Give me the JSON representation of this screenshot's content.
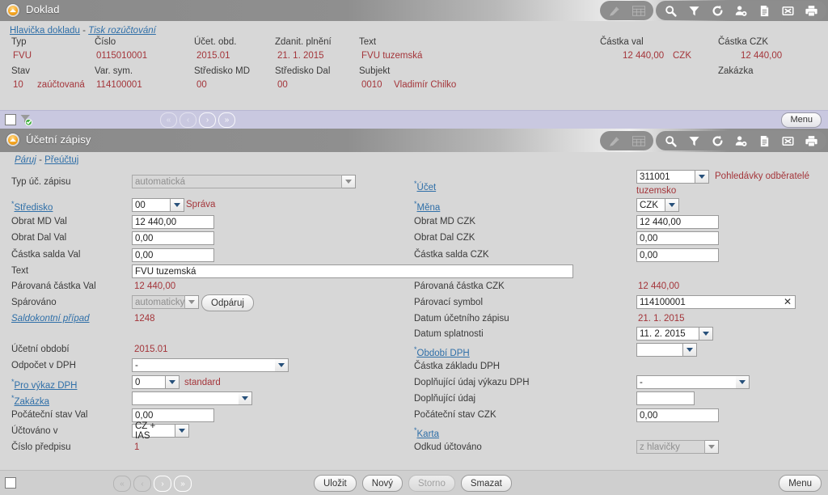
{
  "document_panel": {
    "title": "Doklad",
    "links": [
      {
        "label": "Hlavička dokladu",
        "style": "normal"
      },
      {
        "label": "Tisk rozúčtování",
        "style": "italic"
      }
    ],
    "link_separator": "-",
    "fields": [
      {
        "label": "Typ",
        "value": "FVU"
      },
      {
        "label": "Číslo",
        "value": "0115010001"
      },
      {
        "label": "Účet. obd.",
        "value": "2015.01"
      },
      {
        "label": "Zdanit. plnění",
        "value": "21. 1. 2015"
      },
      {
        "label": "Text",
        "value": "FVU tuzemská"
      },
      {
        "label": "Částka val",
        "value": "12 440,00",
        "suffix": "CZK"
      },
      {
        "label": "Částka CZK",
        "value": "12 440,00"
      },
      {
        "label": "Stav",
        "value": "10",
        "value2": "zaúčtovaná"
      },
      {
        "label": "Var. sym.",
        "value": "114100001"
      },
      {
        "label": "Středisko MD",
        "value": "00"
      },
      {
        "label": "Středisko Dal",
        "value": "00"
      },
      {
        "label": "Subjekt",
        "value": "0010",
        "value2": "Vladimír Chilko"
      },
      {
        "label": "Zakázka",
        "value": ""
      }
    ]
  },
  "toolbar": {
    "icons": [
      {
        "name": "edit-icon",
        "state": "disabled"
      },
      {
        "name": "grid-icon",
        "state": "disabled"
      },
      {
        "name": "search-icon",
        "state": "enabled"
      },
      {
        "name": "filter-icon",
        "state": "enabled"
      },
      {
        "name": "refresh-icon",
        "state": "enabled"
      },
      {
        "name": "user-settings-icon",
        "state": "enabled"
      },
      {
        "name": "document-icon",
        "state": "enabled"
      },
      {
        "name": "excel-export-icon",
        "state": "enabled"
      },
      {
        "name": "print-icon",
        "state": "enabled"
      }
    ]
  },
  "navbar": {
    "first_label": "«",
    "prev_label": "‹",
    "next_label": "›",
    "last_label": "»",
    "menu_label": "Menu"
  },
  "entries_panel": {
    "title": "Účetní zápisy",
    "links": [
      {
        "label": "Páruj",
        "style": "italic"
      },
      {
        "label": "Přeúčtuj",
        "style": "normal"
      }
    ],
    "link_separator": "-",
    "left": {
      "typ_uc_zapisu": {
        "label": "Typ úč. zápisu",
        "value": "automatická"
      },
      "stredisko": {
        "label": "Středisko",
        "value": "00",
        "note": "Správa"
      },
      "obrat_md_val": {
        "label": "Obrat MD Val",
        "value": "12 440,00"
      },
      "obrat_dal_val": {
        "label": "Obrat Dal Val",
        "value": "0,00"
      },
      "castka_salda_val": {
        "label": "Částka salda Val",
        "value": "0,00"
      },
      "text": {
        "label": "Text",
        "value": "FVU tuzemská"
      },
      "parovana_val": {
        "label": "Párovaná částka Val",
        "value": "12 440,00"
      },
      "sparovano": {
        "label": "Spárováno",
        "value": "automaticky",
        "button": "Odpáruj"
      },
      "saldokontni": {
        "label": "Saldokontní případ",
        "value": "1248"
      },
      "ucetni_obdobi": {
        "label": "Účetní období",
        "value": "2015.01"
      },
      "odpocet_dph": {
        "label": "Odpočet v DPH",
        "value": "-"
      },
      "pro_vykaz_dph": {
        "label": "Pro výkaz DPH",
        "value": "0",
        "note": "standard"
      },
      "zakazka": {
        "label": "Zakázka",
        "value": ""
      },
      "pocatecni_val": {
        "label": "Počáteční stav Val",
        "value": "0,00"
      },
      "uctovano_v": {
        "label": "Účtováno v",
        "value": "CZ + IAS"
      },
      "cislo_predpisu": {
        "label": "Číslo předpisu",
        "value": "1"
      }
    },
    "right": {
      "ucet": {
        "label": "Účet",
        "value": "311001",
        "note_line1": "Pohledávky odběratelé",
        "note_line2": "tuzemsko"
      },
      "mena": {
        "label": "Měna",
        "value": "CZK"
      },
      "obrat_md_czk": {
        "label": "Obrat MD CZK",
        "value": "12 440,00"
      },
      "obrat_dal_czk": {
        "label": "Obrat Dal CZK",
        "value": "0,00"
      },
      "castka_salda_czk": {
        "label": "Částka salda CZK",
        "value": "0,00"
      },
      "parovana_czk": {
        "label": "Párovaná částka CZK",
        "value": "12 440,00"
      },
      "parovaci_symbol": {
        "label": "Párovací symbol",
        "value": "114100001"
      },
      "datum_zapisu": {
        "label": "Datum účetního zápisu",
        "value": "21. 1. 2015"
      },
      "datum_splatnosti": {
        "label": "Datum splatnosti",
        "value": "11. 2. 2015"
      },
      "obdobi_dph": {
        "label": "Období DPH",
        "value": ""
      },
      "castka_zakladu": {
        "label": "Částka základu DPH",
        "value": ""
      },
      "dopl_vykaz_dph": {
        "label": "Doplňující údaj výkazu DPH",
        "value": "-"
      },
      "dopl_udaj": {
        "label": "Doplňující údaj",
        "value": ""
      },
      "pocatecni_czk": {
        "label": "Počáteční stav CZK",
        "value": "0,00"
      },
      "karta": {
        "label": "Karta",
        "value": ""
      },
      "odkud_uctovano": {
        "label": "Odkud účtováno",
        "value": "z hlavičky"
      }
    }
  },
  "bottombar": {
    "save_label": "Uložit",
    "new_label": "Nový",
    "cancel_label": "Storno",
    "delete_label": "Smazat",
    "menu_label": "Menu"
  },
  "colors": {
    "value_red": "#a4353a",
    "link_blue": "#2f6fa8",
    "panel_grey": "#d7d7d7",
    "nav_purple": "#c9c8e0",
    "titlebar_grey": "#8a8a8a",
    "focus_blue": "#dbe8f7"
  }
}
